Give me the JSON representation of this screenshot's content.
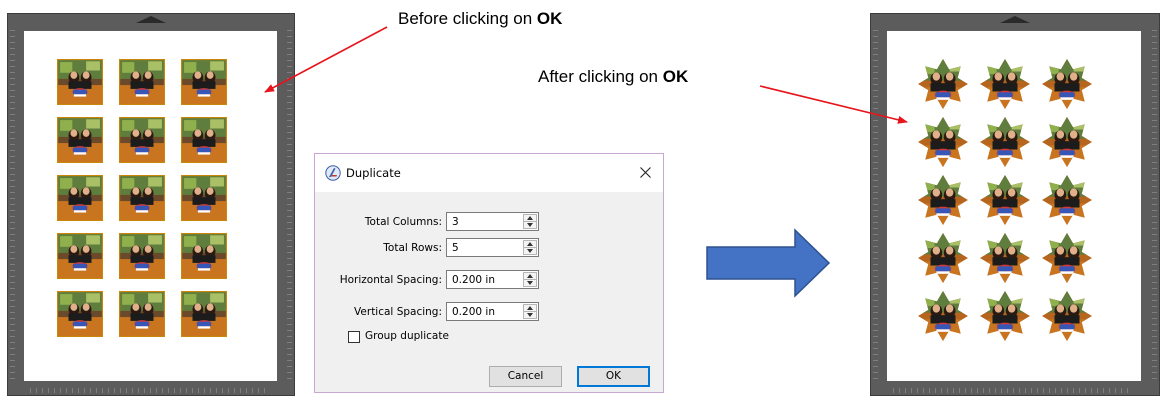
{
  "annotations": {
    "before_prefix": "Before clicking on ",
    "before_bold": "OK",
    "after_prefix": "After clicking on ",
    "after_bold": "OK"
  },
  "colors": {
    "annotation_arrow": "#e8141c",
    "transition_arrow": "#4472c4",
    "transition_arrow_border": "#2e528f",
    "mat": "#5c5c5c",
    "photo_border": "#c8860a",
    "star_fill": "#b5651d"
  },
  "left_mat": {
    "grid": {
      "columns": 3,
      "rows": 5,
      "item_shape": "square-photo"
    }
  },
  "right_mat": {
    "grid": {
      "columns": 3,
      "rows": 5,
      "item_shape": "star-photo"
    }
  },
  "dialog": {
    "app_icon": "silhouette-studio-icon",
    "title": "Duplicate",
    "close_icon": "close-icon",
    "fields": [
      {
        "label": "Total Columns:",
        "value": "3"
      },
      {
        "label": "Total Rows:",
        "value": "5"
      },
      {
        "label": "Horizontal Spacing:",
        "value": "0.200 in"
      },
      {
        "label": "Vertical Spacing:",
        "value": "0.200 in"
      }
    ],
    "group_duplicate": {
      "label": "Group duplicate",
      "checked": false
    },
    "cancel_label": "Cancel",
    "ok_label": "OK"
  }
}
